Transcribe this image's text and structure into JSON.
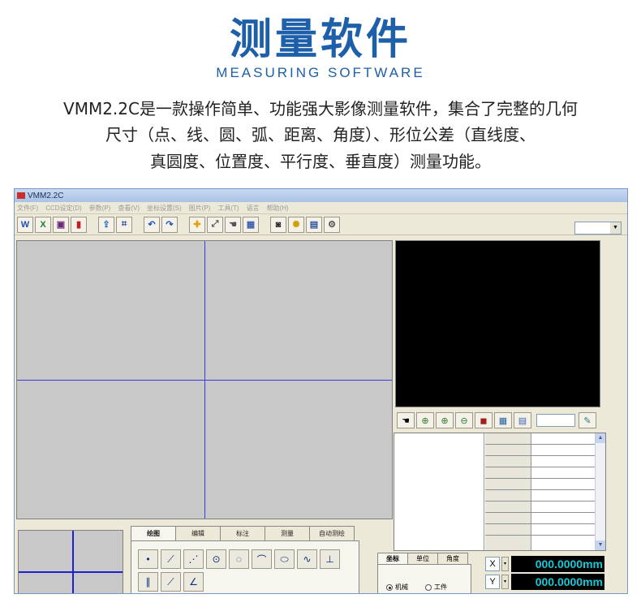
{
  "header": {
    "title": "测量软件",
    "subtitle": "MEASURING SOFTWARE",
    "description_lines": [
      "VMM2.2C是一款操作简单、功能强大影像测量软件，集合了完整的几何",
      "尺寸（点、线、圆、弧、距离、角度）、形位公差（直线度、",
      "真圆度、位置度、平行度、垂直度）测量功能。"
    ]
  },
  "window": {
    "title": "VMM2.2C",
    "menu": [
      "文件(F)",
      "CCD设定(D)",
      "参数(P)",
      "查看(V)",
      "坐标设置(S)",
      "图片(P)",
      "工具(T)",
      "语言",
      "帮助(H)"
    ],
    "toolbar_icons": [
      "word-icon",
      "excel-icon",
      "save-icon",
      "chart-icon",
      "export-icon",
      "graph-icon",
      "undo-icon",
      "redo-icon",
      "crosshair-icon",
      "pick-icon",
      "hand-icon",
      "grid-icon",
      "camera-icon",
      "light-icon",
      "frame-icon",
      "settings-icon"
    ]
  },
  "tools": {
    "tabs": [
      "绘图",
      "编辑",
      "标注",
      "测量",
      "自动测绘"
    ],
    "active_tab": "绘图",
    "row1_icons": [
      "point-tool-icon",
      "line-tool-icon",
      "polyline-tool-icon",
      "circle-tool-icon",
      "circle3-tool-icon",
      "arc-tool-icon",
      "ellipse-tool-icon",
      "curve-tool-icon",
      "perpendicular-tool-icon"
    ],
    "row2_icons": [
      "parallel-tool-icon",
      "angle-line-tool-icon",
      "angle-tool-icon"
    ]
  },
  "coords": {
    "tabs": [
      "坐标",
      "单位",
      "角度"
    ],
    "active_tab": "坐标",
    "radio_machine": "机械",
    "radio_work": "工件",
    "x_label": "X",
    "y_label": "Y",
    "x_value": "000.0000mm",
    "y_value": "000.0000mm"
  },
  "colors": {
    "brand_blue": "#1d5fa8",
    "readout_text": "#19c8d8",
    "crosshair": "#3a3adf"
  }
}
